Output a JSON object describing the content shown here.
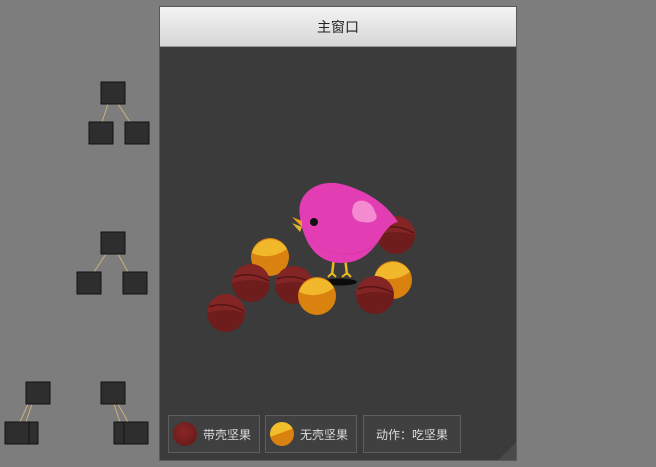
{
  "window": {
    "title": "主窗口"
  },
  "buttons": {
    "nut_with_shell": "带壳坚果",
    "nut_without_shell": "无壳坚果",
    "action": "动作：吃坚果"
  },
  "colors": {
    "shell_nut": "#7a1f1f",
    "shelled_nut": "#e08a10",
    "bird": "#e33db0",
    "canvas_bg": "#3b3b3b"
  }
}
